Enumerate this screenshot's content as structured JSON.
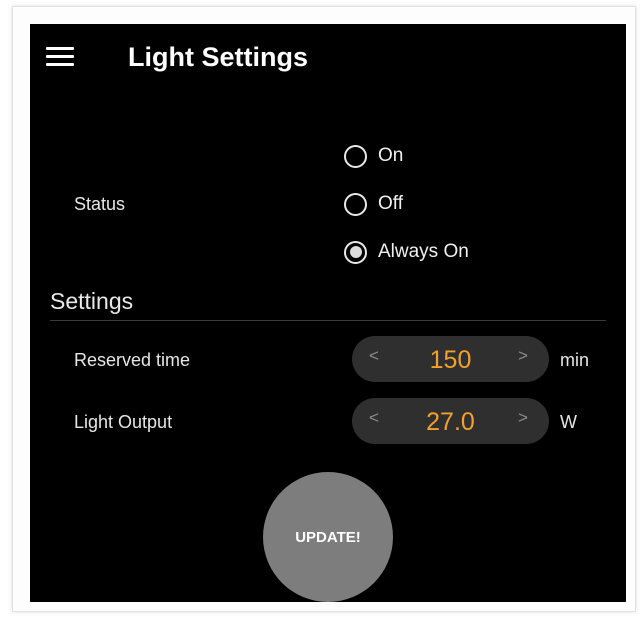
{
  "header": {
    "title": "Light Settings",
    "menu_icon": "hamburger-menu-icon"
  },
  "status": {
    "label": "Status",
    "options": [
      "On",
      "Off",
      "Always On"
    ],
    "selected": "Always On"
  },
  "settings": {
    "section_title": "Settings",
    "reserved_time": {
      "label": "Reserved time",
      "value": "150",
      "unit": "min",
      "decrement": "<",
      "increment": ">"
    },
    "light_output": {
      "label": "Light Output",
      "value": "27.0",
      "unit": "W",
      "decrement": "<",
      "increment": ">"
    }
  },
  "update_button": {
    "label": "UPDATE!"
  },
  "colors": {
    "background": "#000000",
    "value_accent": "#f2a12a",
    "stepper_bg": "#2f2f2f",
    "button_bg": "#7d7d7d"
  }
}
